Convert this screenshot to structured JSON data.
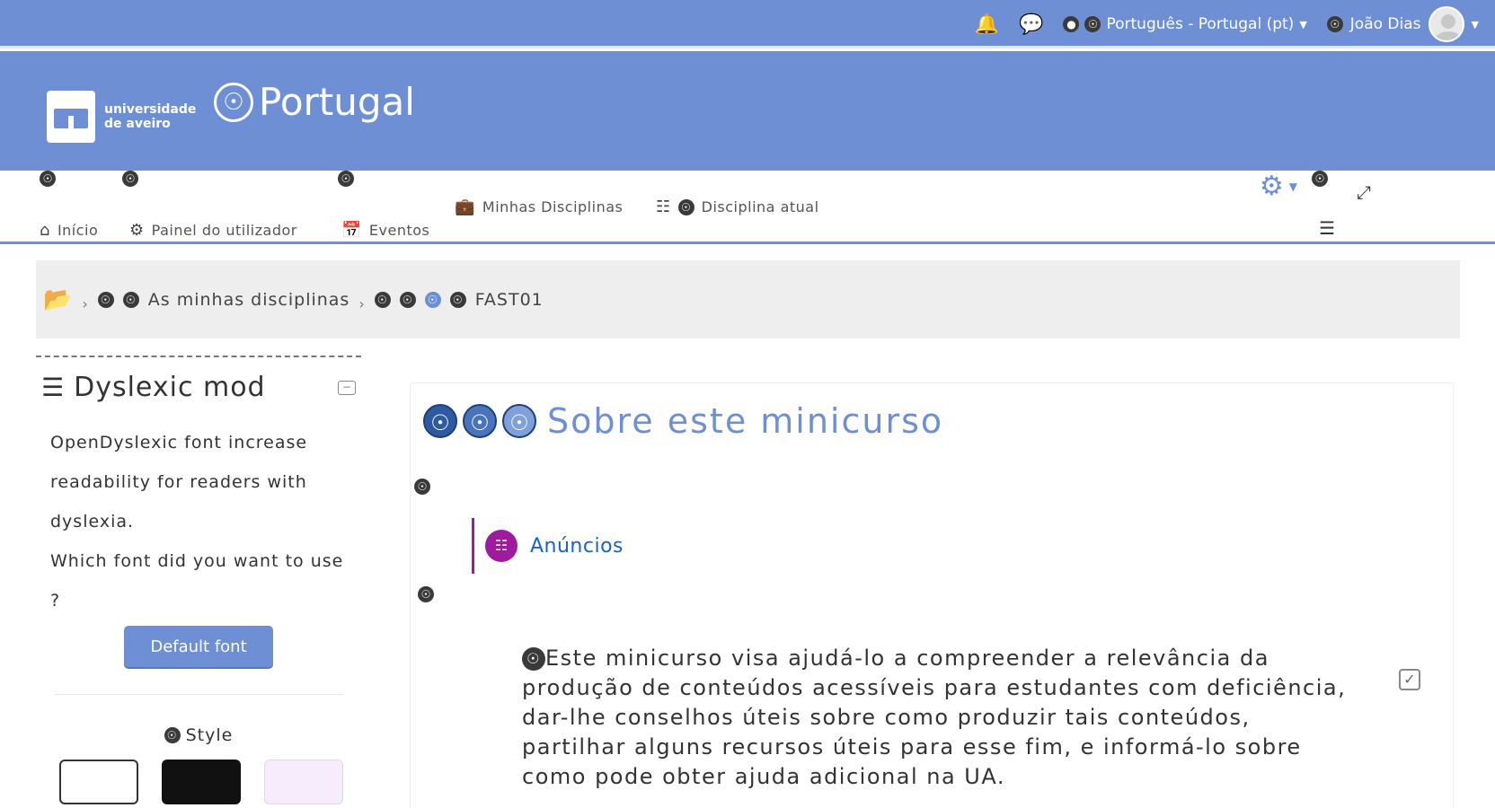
{
  "topbar": {
    "bell_icon": "bell-icon",
    "chat_icon": "chat-icon",
    "language": "Português - Portugal (pt)",
    "user_name": "João Dias",
    "avatar_icon": "avatar-icon"
  },
  "header": {
    "logo_line1": "universidade",
    "logo_line2": "de aveiro",
    "site_name": "Portugal"
  },
  "nav": {
    "home": "Início",
    "dashboard": "Painel do utilizador",
    "events": "Eventos",
    "my_courses": "Minhas Disciplinas",
    "current_course": "Disciplina atual"
  },
  "breadcrumb": {
    "item1": "As minhas disciplinas",
    "item2": "FAST01"
  },
  "sidebar": {
    "title": "Dyslexic mod",
    "text1": "OpenDyslexic font increase readability for readers with dyslexia.",
    "text2": "Which font did you want to use ?",
    "button": "Default font",
    "style_label": "Style",
    "swatches": [
      "#ffffff",
      "#111111",
      "#f6ecfb"
    ]
  },
  "main": {
    "title": "Sobre este minicurso",
    "announcements": "Anúncios",
    "summary": "Este minicurso visa ajudá-lo a compreender a relevância da produção de conteúdos acessíveis para estudantes com deficiência, dar-lhe conselhos úteis sobre como produzir tais conteúdos, partilhar alguns recursos úteis para esse fim, e informá-lo sobre como pode obter ajuda adicional na UA."
  },
  "colors": {
    "brand": "#6e8fd3",
    "forum": "#a01aa0",
    "link": "#1a63c2"
  }
}
